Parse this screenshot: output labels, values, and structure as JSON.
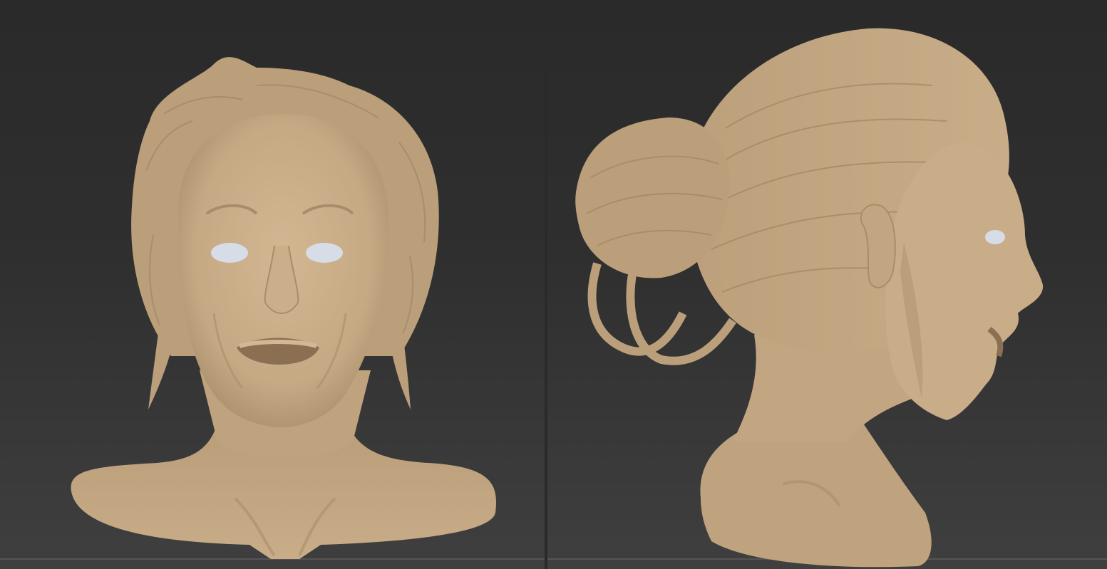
{
  "views": [
    {
      "name": "front-view",
      "subject": "sculpt-bust-front"
    },
    {
      "name": "side-view",
      "subject": "sculpt-bust-side"
    }
  ],
  "colors": {
    "background_top": "#2a2a2a",
    "background_bottom": "#3f3f3f",
    "clay": "#c5a984",
    "clay_shadow": "#a88d6b",
    "clay_highlight": "#d4b894",
    "eye": "#d7dde6"
  }
}
